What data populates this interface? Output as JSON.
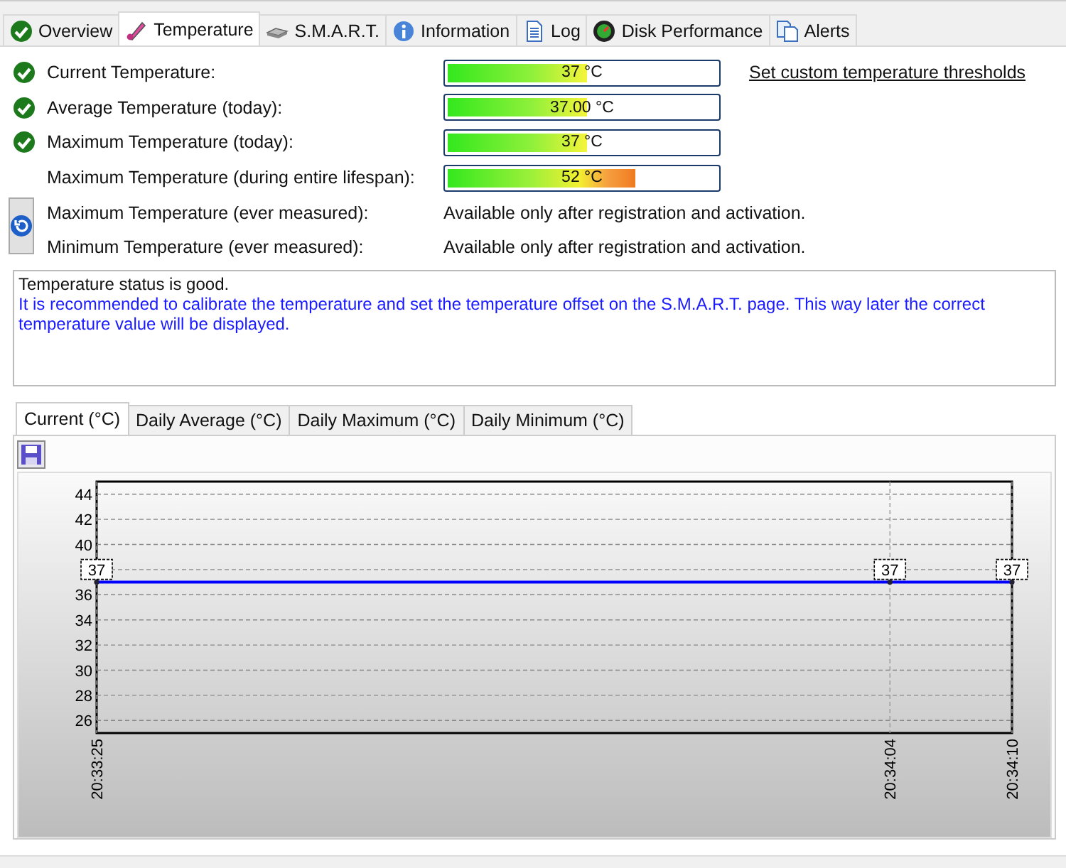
{
  "tabs": [
    {
      "label": "Overview",
      "selected": false
    },
    {
      "label": "Temperature",
      "selected": true
    },
    {
      "label": "S.M.A.R.T.",
      "selected": false
    },
    {
      "label": "Information",
      "selected": false
    },
    {
      "label": "Log",
      "selected": false
    },
    {
      "label": "Disk Performance",
      "selected": false
    },
    {
      "label": "Alerts",
      "selected": false
    }
  ],
  "readings": [
    {
      "label": "Current Temperature:",
      "ok": true,
      "kind": "bar",
      "level": 0.52,
      "value": "37 °C"
    },
    {
      "label": "Average Temperature (today):",
      "ok": true,
      "kind": "bar",
      "level": 0.52,
      "value": "37.00 °C"
    },
    {
      "label": "Maximum Temperature (today):",
      "ok": true,
      "kind": "bar",
      "level": 0.52,
      "value": "37 °C"
    },
    {
      "label": "Maximum Temperature (during entire lifespan):",
      "ok": false,
      "kind": "bar",
      "level": 0.7,
      "value": "52 °C"
    },
    {
      "label": "Maximum Temperature (ever measured):",
      "ok": false,
      "kind": "text",
      "value": "Available only after registration and activation."
    },
    {
      "label": "Minimum Temperature (ever measured):",
      "ok": false,
      "kind": "text",
      "value": "Available only after registration and activation."
    }
  ],
  "thresholds_link": "Set custom temperature thresholds",
  "status_text": {
    "status": "Temperature status is good.",
    "advice": "It is recommended to calibrate the temperature and set the temperature offset on the S.M.A.R.T. page. This way later the correct temperature value will be displayed."
  },
  "chart_tabs": [
    {
      "label": "Current (°C)",
      "selected": true
    },
    {
      "label": "Daily Average (°C)",
      "selected": false
    },
    {
      "label": "Daily Maximum (°C)",
      "selected": false
    },
    {
      "label": "Daily Minimum (°C)",
      "selected": false
    }
  ],
  "chart_data": {
    "type": "line",
    "categories": [
      "20:33:25",
      null,
      null,
      null,
      null,
      null,
      null,
      null,
      null,
      null,
      null,
      null,
      null,
      null,
      null,
      null,
      null,
      null,
      null,
      null,
      null,
      null,
      null,
      null,
      null,
      null,
      null,
      null,
      null,
      null,
      null,
      null,
      null,
      null,
      null,
      null,
      null,
      null,
      null,
      "20:34:04",
      null,
      null,
      null,
      null,
      null,
      "20:34:10"
    ],
    "grid": true,
    "series": [
      {
        "color": "#0000ff",
        "marker": true,
        "values": [
          37,
          null,
          null,
          null,
          null,
          null,
          null,
          null,
          null,
          null,
          null,
          null,
          null,
          null,
          null,
          null,
          null,
          null,
          null,
          null,
          null,
          null,
          null,
          null,
          null,
          null,
          null,
          null,
          null,
          null,
          null,
          null,
          null,
          null,
          null,
          null,
          null,
          null,
          null,
          37,
          null,
          null,
          null,
          null,
          null,
          37
        ]
      }
    ],
    "ylim": [
      25,
      45
    ],
    "yticks": [
      26,
      28,
      30,
      32,
      34,
      36,
      40,
      42,
      44
    ],
    "data_labels": true
  }
}
